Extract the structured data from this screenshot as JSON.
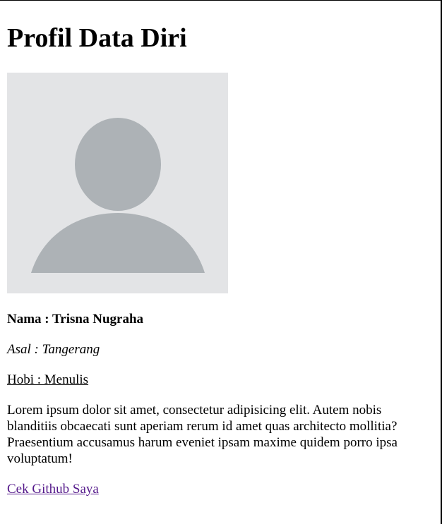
{
  "profile": {
    "title": "Profil Data Diri",
    "avatar": {
      "icon": "user-placeholder-icon",
      "background_color": "#e3e4e6",
      "figure_color": "#adb2b6"
    },
    "nama": "Nama : Trisna Nugraha",
    "asal": "Asal : Tangerang",
    "hobi": "Hobi : Menulis",
    "description": "Lorem ipsum dolor sit amet, consectetur adipisicing elit. Autem nobis blanditiis obcaecati sunt aperiam rerum id amet quas architecto mollitia? Praesentium accusamus harum eveniet ipsam maxime quidem porro ipsa voluptatum!",
    "link_label": "Cek Github Saya",
    "link_color": "#551a8b"
  }
}
